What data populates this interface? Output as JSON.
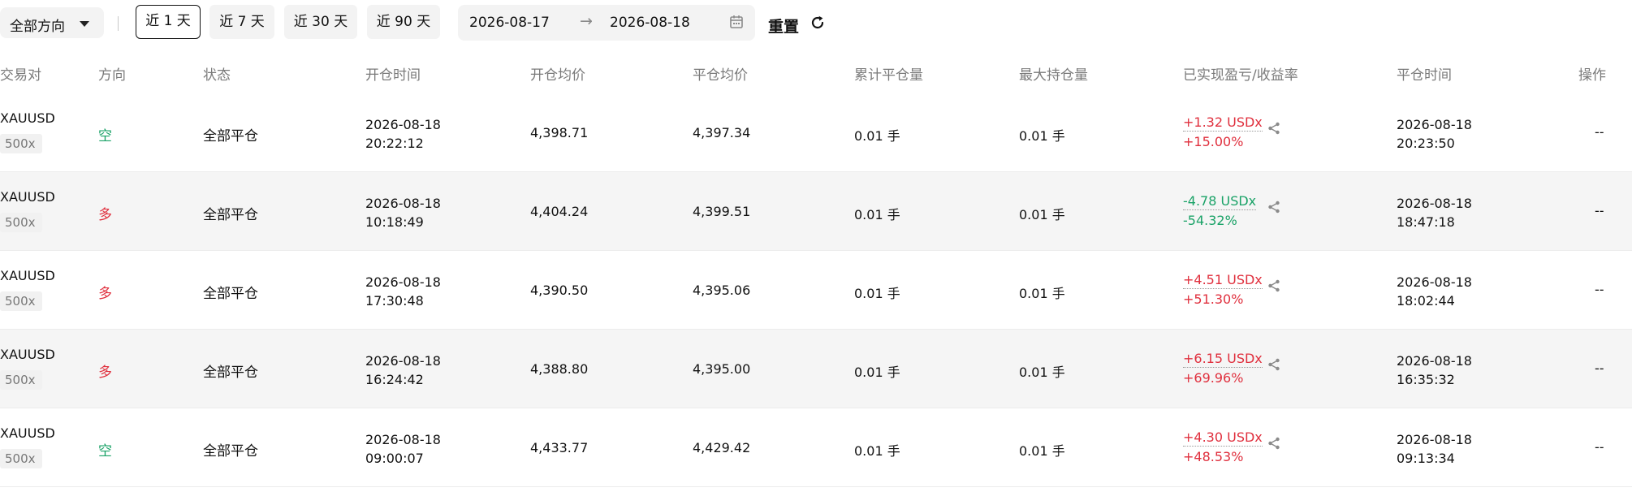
{
  "filters": {
    "direction_label": "全部方向",
    "ranges": [
      {
        "label": "近 1 天",
        "active": true
      },
      {
        "label": "近 7 天",
        "active": false
      },
      {
        "label": "近 30 天",
        "active": false
      },
      {
        "label": "近 90 天",
        "active": false
      }
    ],
    "date_start": "2026-08-17",
    "date_arrow": "→",
    "date_end": "2026-08-18",
    "reset_label": "重置"
  },
  "table": {
    "headers": [
      "交易对",
      "方向",
      "状态",
      "开仓时间",
      "开仓均价",
      "平仓均价",
      "累计平仓量",
      "最大持仓量",
      "已实现盈亏/收益率",
      "平仓时间",
      "操作"
    ],
    "rows": [
      {
        "pair": "XAUUSD",
        "leverage": "500x",
        "direction": "空",
        "direction_type": "short",
        "status": "全部平仓",
        "open_date": "2026-08-18",
        "open_time": "20:22:12",
        "open_price": "4,398.71",
        "close_price": "4,397.34",
        "closed_qty": "0.01 手",
        "max_qty": "0.01 手",
        "pnl": "+1.32 USDx",
        "pnl_rate": "+15.00%",
        "pnl_sign": "pos",
        "close_date": "2026-08-18",
        "close_time": "20:23:50",
        "action": "--"
      },
      {
        "pair": "XAUUSD",
        "leverage": "500x",
        "direction": "多",
        "direction_type": "long",
        "status": "全部平仓",
        "open_date": "2026-08-18",
        "open_time": "10:18:49",
        "open_price": "4,404.24",
        "close_price": "4,399.51",
        "closed_qty": "0.01 手",
        "max_qty": "0.01 手",
        "pnl": "-4.78 USDx",
        "pnl_rate": "-54.32%",
        "pnl_sign": "neg",
        "close_date": "2026-08-18",
        "close_time": "18:47:18",
        "action": "--"
      },
      {
        "pair": "XAUUSD",
        "leverage": "500x",
        "direction": "多",
        "direction_type": "long",
        "status": "全部平仓",
        "open_date": "2026-08-18",
        "open_time": "17:30:48",
        "open_price": "4,390.50",
        "close_price": "4,395.06",
        "closed_qty": "0.01 手",
        "max_qty": "0.01 手",
        "pnl": "+4.51 USDx",
        "pnl_rate": "+51.30%",
        "pnl_sign": "pos",
        "close_date": "2026-08-18",
        "close_time": "18:02:44",
        "action": "--"
      },
      {
        "pair": "XAUUSD",
        "leverage": "500x",
        "direction": "多",
        "direction_type": "long",
        "status": "全部平仓",
        "open_date": "2026-08-18",
        "open_time": "16:24:42",
        "open_price": "4,388.80",
        "close_price": "4,395.00",
        "closed_qty": "0.01 手",
        "max_qty": "0.01 手",
        "pnl": "+6.15 USDx",
        "pnl_rate": "+69.96%",
        "pnl_sign": "pos",
        "close_date": "2026-08-18",
        "close_time": "16:35:32",
        "action": "--"
      },
      {
        "pair": "XAUUSD",
        "leverage": "500x",
        "direction": "空",
        "direction_type": "short",
        "status": "全部平仓",
        "open_date": "2026-08-18",
        "open_time": "09:00:07",
        "open_price": "4,433.77",
        "close_price": "4,429.42",
        "closed_qty": "0.01 手",
        "max_qty": "0.01 手",
        "pnl": "+4.30 USDx",
        "pnl_rate": "+48.53%",
        "pnl_sign": "pos",
        "close_date": "2026-08-18",
        "close_time": "09:13:34",
        "action": "--"
      }
    ]
  },
  "colors": {
    "positive": "#e0303e",
    "negative": "#1aa267",
    "zebra": "#f5f5f5"
  },
  "icons": {
    "direction_caret": "caret-down-icon",
    "date_arrow": "arrow-right-icon",
    "calendar": "calendar-icon",
    "reset": "refresh-icon",
    "share": "share-icon"
  }
}
